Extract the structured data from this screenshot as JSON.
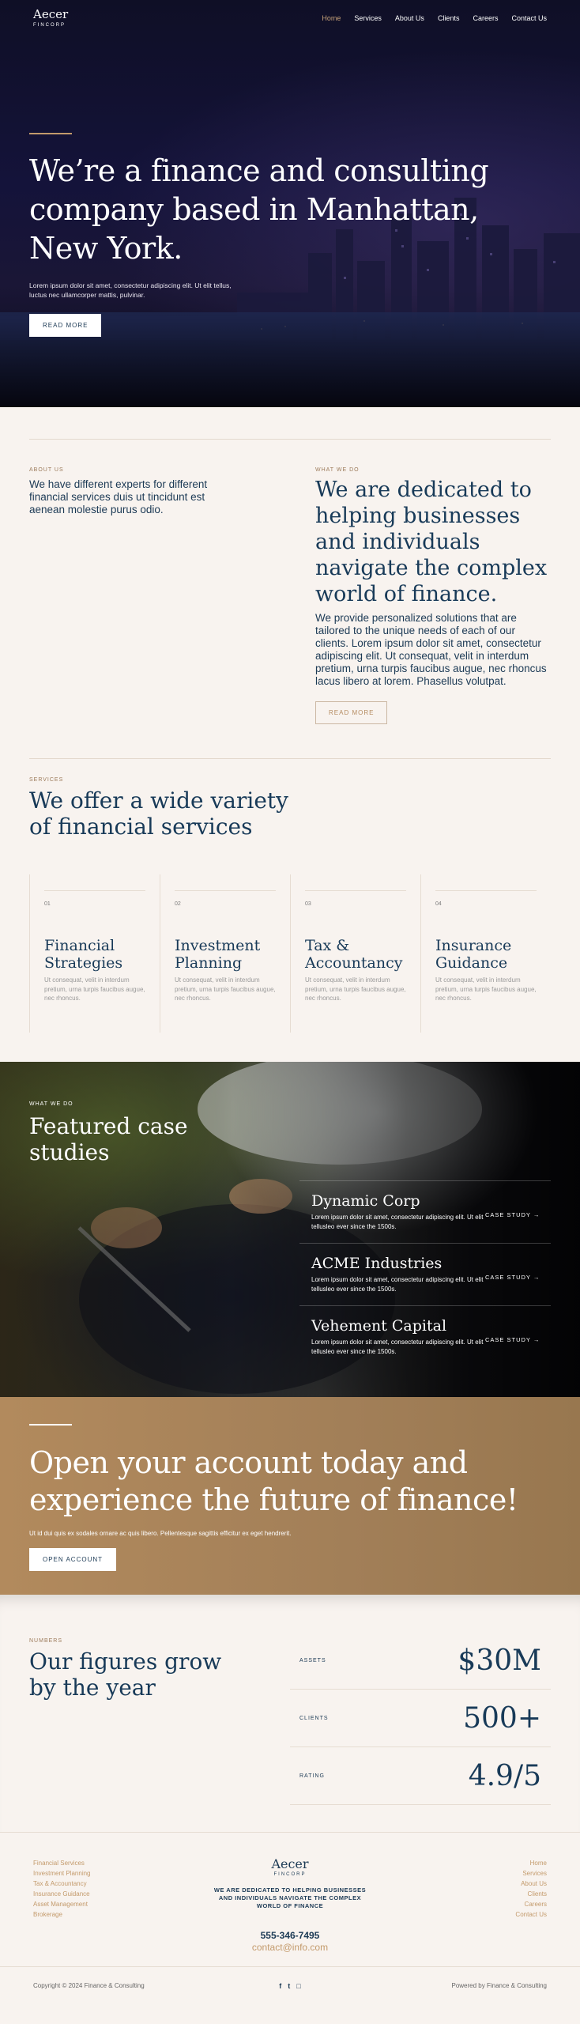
{
  "nav": {
    "logo_name": "Aecer",
    "logo_sub": "FINCORP",
    "items": [
      "Home",
      "Services",
      "About Us",
      "Clients",
      "Careers",
      "Contact Us"
    ]
  },
  "hero": {
    "title": "We’re a finance and consulting company based in Manhattan, New York.",
    "text": "Lorem ipsum dolor sit amet, consectetur adipiscing elit. Ut elit tellus, luctus nec ullamcorper mattis, pulvinar.",
    "button": "READ MORE"
  },
  "about": {
    "eyebrow": "ABOUT US",
    "lead": "We have different experts for different financial services duis ut tincidunt est aenean molestie purus odio.",
    "what_eyebrow": "WHAT WE DO",
    "heading": "We are dedicated to helping businesses and individuals navigate the complex world of finance.",
    "body": "We provide personalized solutions that are tailored to the unique needs of each of our clients. Lorem ipsum dolor sit amet, consectetur adipiscing elit. Ut consequat, velit in interdum pretium, urna turpis faucibus augue, nec rhoncus lacus libero at lorem. Phasellus volutpat.",
    "button": "READ MORE"
  },
  "services": {
    "eyebrow": "SERVICES",
    "heading": "We offer a wide variety of financial services",
    "items": [
      {
        "num": "01",
        "title": "Financial Strategies",
        "text": "Ut consequat, velit in interdum pretium, urna turpis faucibus augue, nec rhoncus."
      },
      {
        "num": "02",
        "title": "Investment Planning",
        "text": "Ut consequat, velit in interdum pretium, urna turpis faucibus augue, nec rhoncus."
      },
      {
        "num": "03",
        "title": "Tax & Accountancy",
        "text": "Ut consequat, velit in interdum pretium, urna turpis faucibus augue, nec rhoncus."
      },
      {
        "num": "04",
        "title": "Insurance Guidance",
        "text": "Ut consequat, velit in interdum pretium, urna turpis faucibus augue, nec rhoncus."
      }
    ]
  },
  "cases": {
    "eyebrow": "WHAT WE DO",
    "heading": "Featured case studies",
    "items": [
      {
        "title": "Dynamic Corp",
        "text": "Lorem ipsum dolor sit amet, consectetur adipiscing elit. Ut elit tellusleo ever since the 1500s.",
        "link": "CASE STUDY"
      },
      {
        "title": "ACME Industries",
        "text": "Lorem ipsum dolor sit amet, consectetur adipiscing elit. Ut elit tellusleo ever since the 1500s.",
        "link": "CASE STUDY"
      },
      {
        "title": "Vehement Capital",
        "text": "Lorem ipsum dolor sit amet, consectetur adipiscing elit. Ut elit tellusleo ever since the 1500s.",
        "link": "CASE STUDY"
      }
    ]
  },
  "cta": {
    "heading": "Open your account today and experience the future of finance!",
    "text": "Ut id dui quis ex sodales ornare ac quis libero. Pellentesque sagittis efficitur ex eget hendrerit.",
    "button": "OPEN ACCOUNT"
  },
  "numbers": {
    "eyebrow": "NUMBERS",
    "heading": "Our figures grow by the year",
    "stats": [
      {
        "label": "ASSETS",
        "value": "$30M"
      },
      {
        "label": "CLIENTS",
        "value": "500+"
      },
      {
        "label": "RATING",
        "value": "4.9/5"
      }
    ]
  },
  "footer": {
    "left_links": [
      "Financial Services",
      "Investment Planning",
      "Tax & Accountancy",
      "Insurance Guidance",
      "Asset Management",
      "Brokerage"
    ],
    "right_links": [
      "Home",
      "Services",
      "About Us",
      "Clients",
      "Careers",
      "Contact Us"
    ],
    "logo_name": "Aecer",
    "logo_sub": "FINCORP",
    "tagline": "WE ARE DEDICATED TO HELPING BUSINESSES AND INDIVIDUALS NAVIGATE THE COMPLEX WORLD OF FINANCE",
    "phone": "555-346-7495",
    "email": "contact@info.com",
    "copyright": "Copyright © 2024 Finance & Consulting",
    "powered": "Powered by Finance & Consulting",
    "social_icons": [
      "facebook-icon",
      "twitter-icon",
      "instagram-icon"
    ]
  }
}
